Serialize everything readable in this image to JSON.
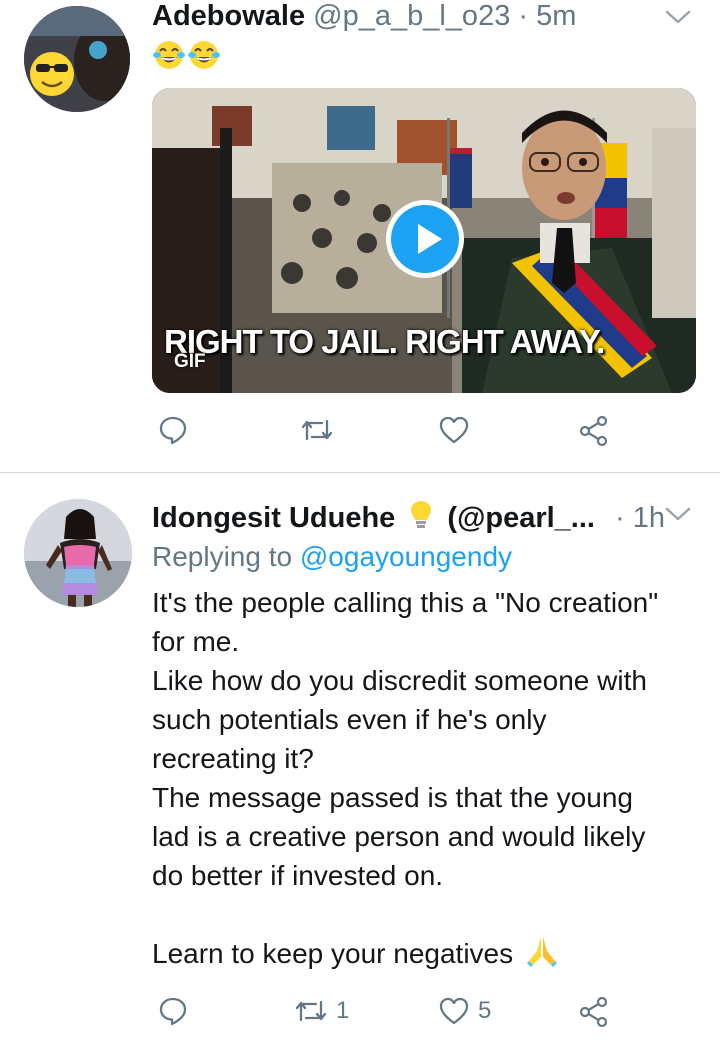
{
  "tweets": [
    {
      "name": "Adebowale",
      "handle": "@p_a_b_l_o23",
      "separator": "·",
      "time": "5m",
      "emojis": [
        "joy-emoji",
        "joy-emoji"
      ],
      "media": {
        "type": "gif",
        "caption": "RIGHT TO JAIL. RIGHT AWAY.",
        "badge": "GIF"
      },
      "actions": {
        "reply_count": "",
        "retweet_count": "",
        "like_count": ""
      }
    },
    {
      "name": "Idongesit Uduehe",
      "name_emoji": "light-bulb-emoji",
      "handle": "(@pearl_...",
      "separator": "·",
      "time": "1h",
      "replying_prefix": "Replying to",
      "replying_handle": "@ogayoungendy",
      "body_lines": [
        "It's the people calling this a \"No creation\"",
        "for me.",
        "Like how do you discredit someone with",
        "such potentials even if he's only",
        "recreating it?",
        "The message passed is that the young",
        "lad is a creative person and would likely",
        "do better if invested on.",
        "",
        "Learn to keep your negatives"
      ],
      "body_end_emoji": "folded-hands-emoji",
      "actions": {
        "reply_count": "",
        "retweet_count": "1",
        "like_count": "5"
      }
    }
  ],
  "colors": {
    "text": "#14171a",
    "muted": "#657786",
    "accent": "#1da1f2",
    "divider": "#d4d9de"
  },
  "icons": [
    "chevron-down-icon",
    "reply-icon",
    "retweet-icon",
    "like-icon",
    "share-icon",
    "play-icon"
  ]
}
